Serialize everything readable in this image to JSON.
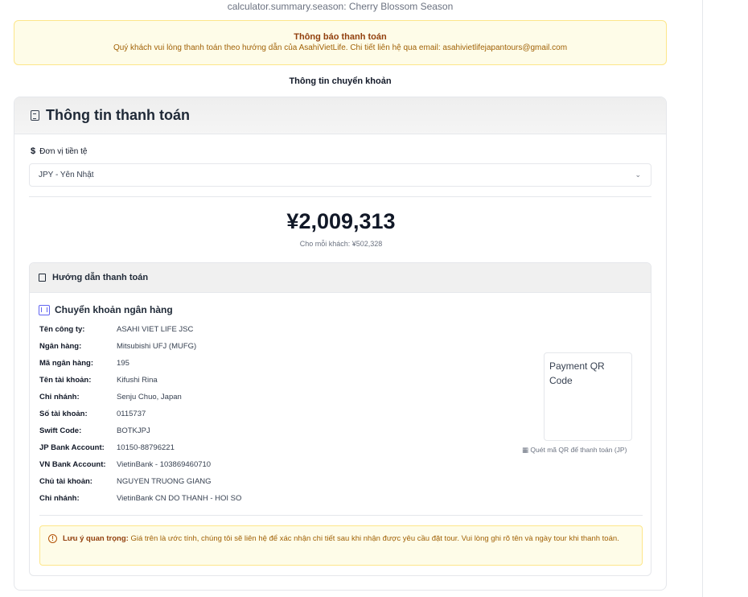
{
  "season_line": "calculator.summary.season: Cherry Blossom Season",
  "notice": {
    "title": "Thông báo thanh toán",
    "text": "Quý khách vui lòng thanh toán theo hướng dẫn của AsahiVietLife. Chi tiết liên hệ qua email: asahivietlifejapantours@gmail.com"
  },
  "transfer_heading": "Thông tin chuyển khoản",
  "card": {
    "title": "Thông tin thanh toán",
    "currency_label": "Đơn vị tiền tệ",
    "currency_symbol": "$",
    "currency_value": "JPY - Yên Nhật",
    "total": "¥2,009,313",
    "per_person": "Cho mỗi khách: ¥502,328"
  },
  "guide": {
    "title": "Hướng dẫn thanh toán",
    "bank_title": "Chuyển khoản ngân hàng",
    "rows": [
      {
        "k": "Tên công ty:",
        "v": "ASAHI VIET LIFE JSC"
      },
      {
        "k": "Ngân hàng:",
        "v": "Mitsubishi UFJ (MUFG)"
      },
      {
        "k": "Mã ngân hàng:",
        "v": "195"
      },
      {
        "k": "Tên tài khoản:",
        "v": "Kifushi Rina"
      },
      {
        "k": "Chi nhánh:",
        "v": "Senju Chuo, Japan"
      },
      {
        "k": "Số tài khoản:",
        "v": "0115737"
      },
      {
        "k": "Swift Code:",
        "v": "BOTKJPJ"
      },
      {
        "k": "JP Bank Account:",
        "v": "10150-88796221"
      },
      {
        "k": "VN Bank Account:",
        "v": "VietinBank - 103869460710"
      },
      {
        "k": "Chủ tài khoản:",
        "v": "NGUYEN TRUONG GIANG"
      },
      {
        "k": "Chi nhánh:",
        "v": "VietinBank CN DO THANH - HOI SO"
      }
    ],
    "qr_alt": "Payment QR Code",
    "qr_caption": "Quét mã QR để thanh toán (JP)",
    "warning_label": "Lưu ý quan trọng:",
    "warning_text": "Giá trên là ước tính, chúng tôi sẽ liên hệ để xác nhận chi tiết sau khi nhận được yêu cầu đặt tour. Vui lòng ghi rõ tên và ngày tour khi thanh toán."
  }
}
